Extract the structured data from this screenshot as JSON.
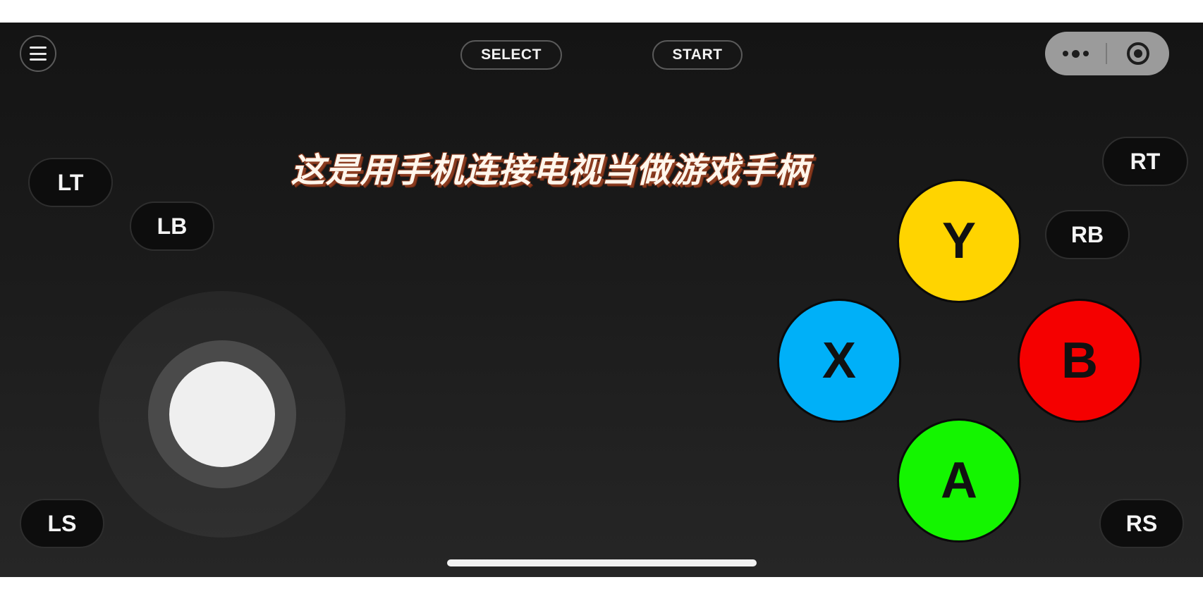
{
  "caption": "这是用手机连接电视当做游戏手柄",
  "top_bar": {
    "select_label": "SELECT",
    "start_label": "START"
  },
  "shoulders": {
    "lt": "LT",
    "lb": "LB",
    "rt": "RT",
    "rb": "RB",
    "ls": "LS",
    "rs": "RS"
  },
  "face_buttons": {
    "y": "Y",
    "x": "X",
    "b": "B",
    "a": "A"
  },
  "colors": {
    "y": "#ffd400",
    "x": "#00b0f8",
    "b": "#f50000",
    "a": "#14f500"
  },
  "icons": {
    "menu": "hamburger-menu-icon",
    "more": "more-dots-icon",
    "close": "close-target-icon"
  }
}
